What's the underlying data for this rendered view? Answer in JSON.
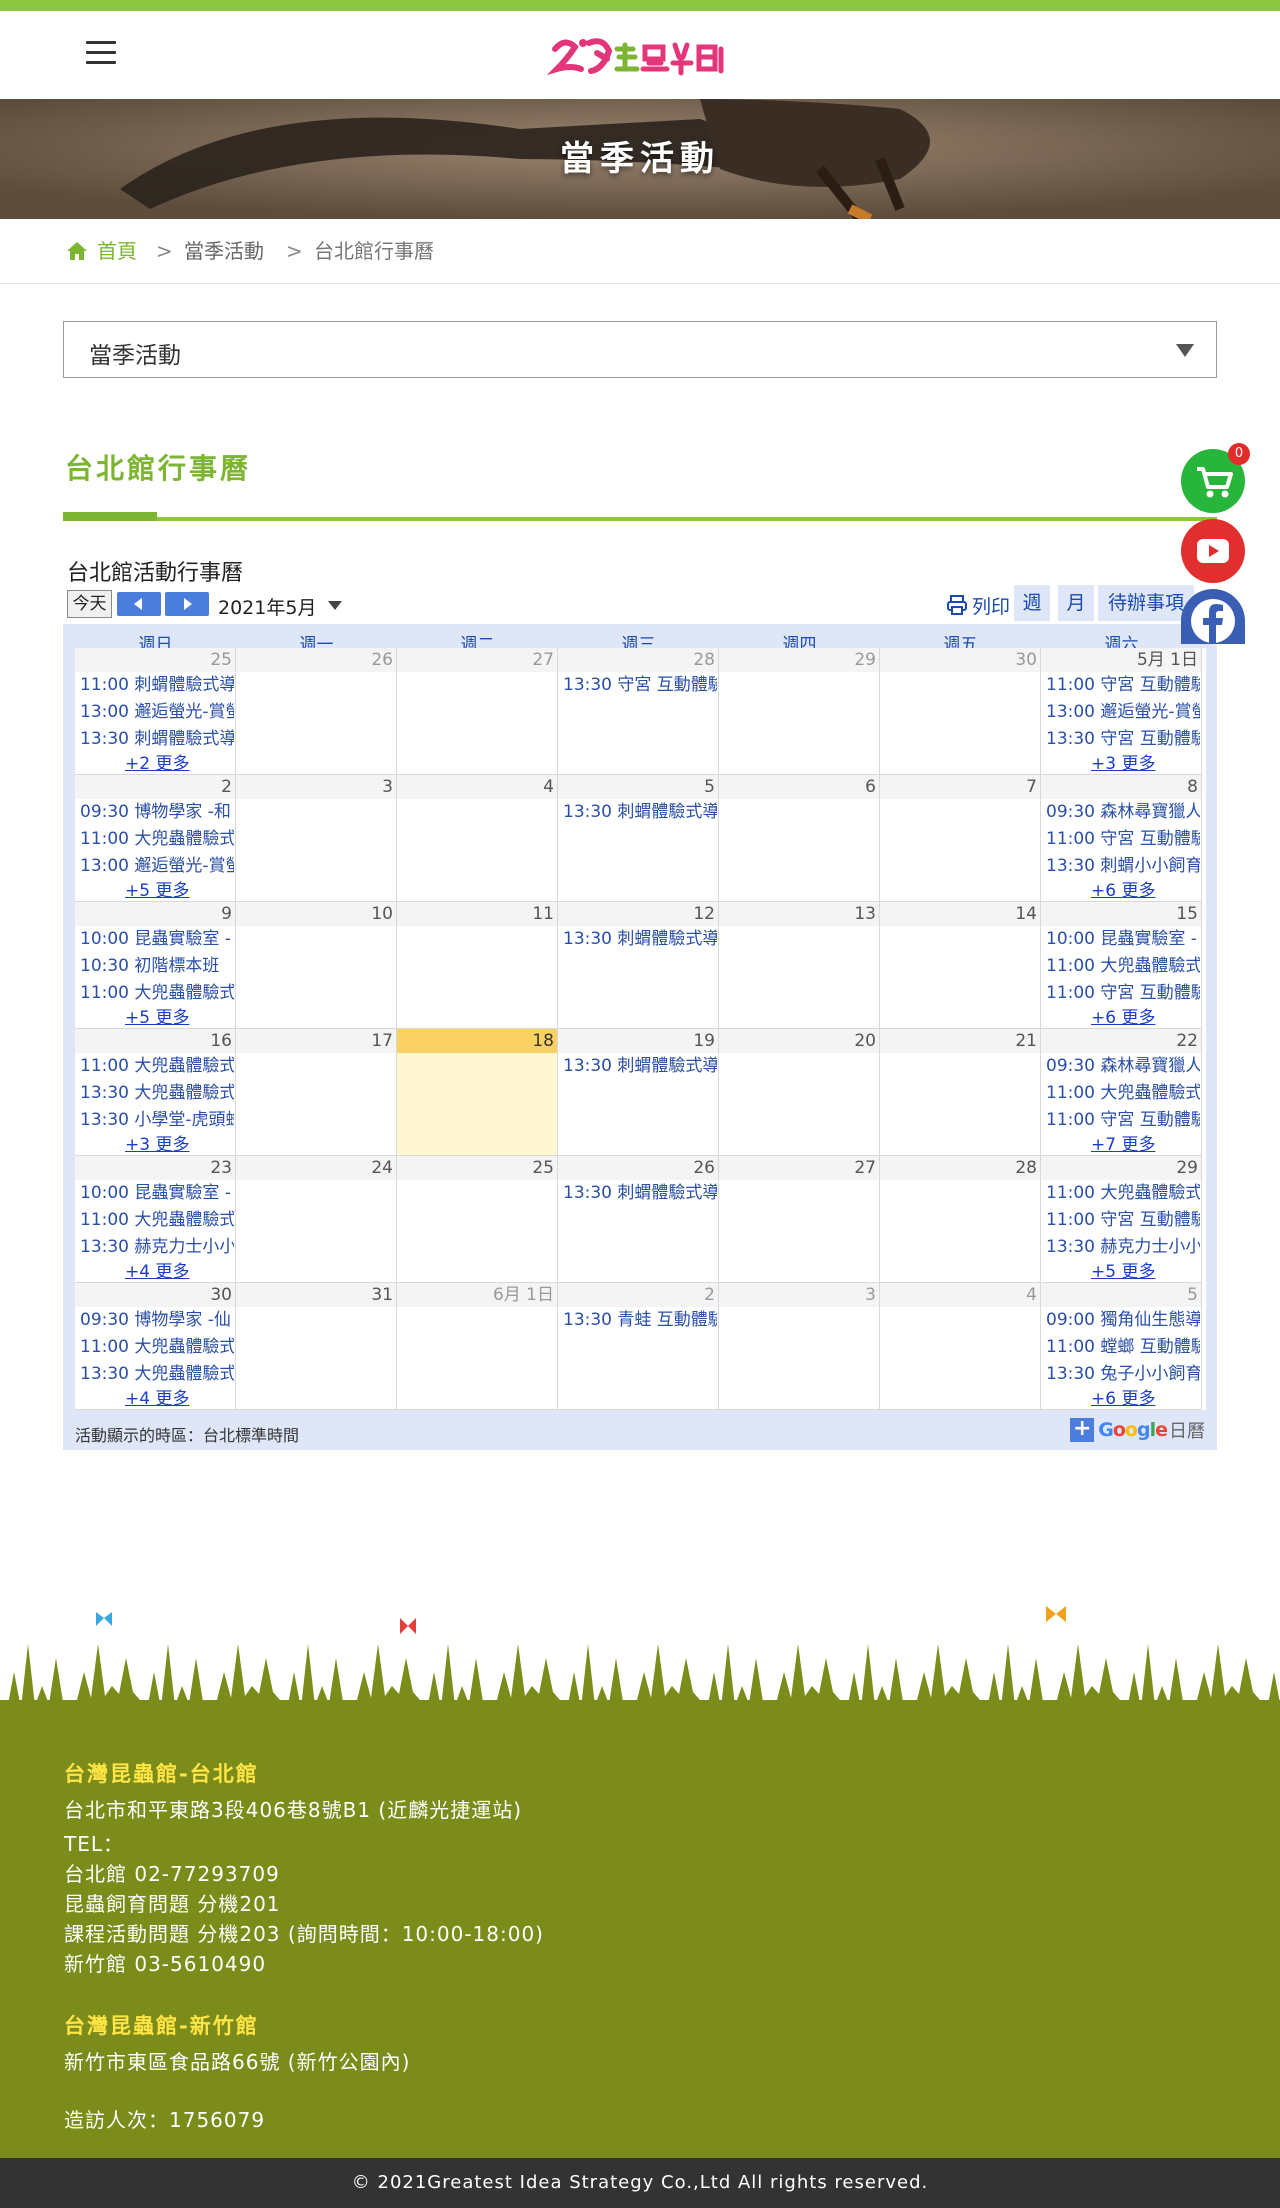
{
  "header": {
    "logo_text": "台灣昆蟲館",
    "banner_title": "當季活動"
  },
  "breadcrumb": {
    "home": "首頁",
    "separator": ">",
    "level2": "當季活動",
    "level3": "台北館行事曆"
  },
  "category_select": {
    "value": "當季活動"
  },
  "section": {
    "title": "台北館行事曆"
  },
  "calendar": {
    "title": "台北館活動行事曆",
    "today_label": "今天",
    "month_label": "2021年5月",
    "print_label": "列印",
    "view_tabs": {
      "week": "週",
      "month": "月",
      "agenda": "待辦事項"
    },
    "weekdays": [
      "週日",
      "週一",
      "週二",
      "週三",
      "週四",
      "週五",
      "週六"
    ],
    "timezone_note": "活動顯示的時區：台北標準時間",
    "google_label": "Google",
    "google_suffix": "日曆",
    "weeks": [
      [
        {
          "day": "25",
          "dim": true,
          "events": [
            "11:00 刺蝟體驗式導",
            "13:00 邂逅螢光-賞螢",
            "13:30 刺蝟體驗式導"
          ],
          "more": "+2 更多"
        },
        {
          "day": "26",
          "dim": true,
          "events": [],
          "more": ""
        },
        {
          "day": "27",
          "dim": true,
          "events": [],
          "more": ""
        },
        {
          "day": "28",
          "dim": true,
          "events": [
            "13:30 守宮 互動體驗"
          ],
          "more": ""
        },
        {
          "day": "29",
          "dim": true,
          "events": [],
          "more": ""
        },
        {
          "day": "30",
          "dim": true,
          "events": [],
          "more": ""
        },
        {
          "day": "5月 1日",
          "dim": false,
          "events": [
            "11:00 守宮 互動體驗",
            "13:00 邂逅螢光-賞螢",
            "13:30 守宮 互動體驗"
          ],
          "more": "+3 更多"
        }
      ],
      [
        {
          "day": "2",
          "dim": false,
          "events": [
            "09:30 博物學家 -和",
            "11:00 大兜蟲體驗式",
            "13:00 邂逅螢光-賞螢"
          ],
          "more": "+5 更多"
        },
        {
          "day": "3",
          "dim": false,
          "events": [],
          "more": ""
        },
        {
          "day": "4",
          "dim": false,
          "events": [],
          "more": ""
        },
        {
          "day": "5",
          "dim": false,
          "events": [
            "13:30 刺蝟體驗式導"
          ],
          "more": ""
        },
        {
          "day": "6",
          "dim": false,
          "events": [],
          "more": ""
        },
        {
          "day": "7",
          "dim": false,
          "events": [],
          "more": ""
        },
        {
          "day": "8",
          "dim": false,
          "events": [
            "09:30 森林尋寶獵人",
            "11:00 守宮 互動體驗",
            "13:30 刺蝟小小飼育"
          ],
          "more": "+6 更多"
        }
      ],
      [
        {
          "day": "9",
          "dim": false,
          "events": [
            "10:00 昆蟲實驗室 -",
            "10:30 初階標本班",
            "11:00 大兜蟲體驗式"
          ],
          "more": "+5 更多"
        },
        {
          "day": "10",
          "dim": false,
          "events": [],
          "more": ""
        },
        {
          "day": "11",
          "dim": false,
          "events": [],
          "more": ""
        },
        {
          "day": "12",
          "dim": false,
          "events": [
            "13:30 刺蝟體驗式導"
          ],
          "more": ""
        },
        {
          "day": "13",
          "dim": false,
          "events": [],
          "more": ""
        },
        {
          "day": "14",
          "dim": false,
          "events": [],
          "more": ""
        },
        {
          "day": "15",
          "dim": false,
          "events": [
            "10:00 昆蟲實驗室 -",
            "11:00 大兜蟲體驗式",
            "11:00 守宮 互動體驗"
          ],
          "more": "+6 更多"
        }
      ],
      [
        {
          "day": "16",
          "dim": false,
          "events": [
            "11:00 大兜蟲體驗式",
            "13:30 大兜蟲體驗式",
            "13:30 小學堂-虎頭蜂"
          ],
          "more": "+3 更多"
        },
        {
          "day": "17",
          "dim": false,
          "events": [],
          "more": ""
        },
        {
          "day": "18",
          "dim": false,
          "today": true,
          "events": [],
          "more": ""
        },
        {
          "day": "19",
          "dim": false,
          "events": [
            "13:30 刺蝟體驗式導"
          ],
          "more": ""
        },
        {
          "day": "20",
          "dim": false,
          "events": [],
          "more": ""
        },
        {
          "day": "21",
          "dim": false,
          "events": [],
          "more": ""
        },
        {
          "day": "22",
          "dim": false,
          "events": [
            "09:30 森林尋寶獵人",
            "11:00 大兜蟲體驗式",
            "11:00 守宮 互動體驗"
          ],
          "more": "+7 更多"
        }
      ],
      [
        {
          "day": "23",
          "dim": false,
          "events": [
            "10:00 昆蟲實驗室 -",
            "11:00 大兜蟲體驗式",
            "13:30 赫克力士小小"
          ],
          "more": "+4 更多"
        },
        {
          "day": "24",
          "dim": false,
          "events": [],
          "more": ""
        },
        {
          "day": "25",
          "dim": false,
          "events": [],
          "more": ""
        },
        {
          "day": "26",
          "dim": false,
          "events": [
            "13:30 刺蝟體驗式導"
          ],
          "more": ""
        },
        {
          "day": "27",
          "dim": false,
          "events": [],
          "more": ""
        },
        {
          "day": "28",
          "dim": false,
          "events": [],
          "more": ""
        },
        {
          "day": "29",
          "dim": false,
          "events": [
            "11:00 大兜蟲體驗式",
            "11:00 守宮 互動體驗",
            "13:30 赫克力士小小"
          ],
          "more": "+5 更多"
        }
      ],
      [
        {
          "day": "30",
          "dim": false,
          "events": [
            "09:30 博物學家 -仙",
            "11:00 大兜蟲體驗式",
            "13:30 大兜蟲體驗式"
          ],
          "more": "+4 更多"
        },
        {
          "day": "31",
          "dim": false,
          "events": [],
          "more": ""
        },
        {
          "day": "6月 1日",
          "dim": true,
          "events": [],
          "more": ""
        },
        {
          "day": "2",
          "dim": true,
          "events": [
            "13:30 青蛙 互動體驗"
          ],
          "more": ""
        },
        {
          "day": "3",
          "dim": true,
          "events": [],
          "more": ""
        },
        {
          "day": "4",
          "dim": true,
          "events": [],
          "more": ""
        },
        {
          "day": "5",
          "dim": true,
          "events": [
            "09:00 獨角仙生態導",
            "11:00 螳螂 互動體驗",
            "13:30 兔子小小飼育"
          ],
          "more": "+6 更多"
        }
      ]
    ]
  },
  "floating": {
    "cart_count": "0"
  },
  "footer": {
    "taipei_title": "台灣昆蟲館-台北館",
    "taipei_address": "台北市和平東路3段406巷8號B1 (近麟光捷運站)",
    "tel_label": "TEL：",
    "tel_taipei": "台北館 02-77293709",
    "tel_breeding": "昆蟲飼育問題 分機201",
    "tel_course": "課程活動問題 分機203 (詢問時間：10:00-18:00)",
    "tel_hsinchu": "新竹館 03-5610490",
    "hsinchu_title": "台灣昆蟲館-新竹館",
    "hsinchu_address": "新竹市東區食品路66號 (新竹公園內)",
    "visitors": "造訪人次：1756079",
    "copyright": "© 2021Greatest Idea Strategy Co.,Ltd All rights reserved."
  },
  "colors": {
    "brand_green": "#8cc63f",
    "footer_olive": "#7b8c1a",
    "footer_heading": "#ffe445",
    "calendar_blue": "#4a7ddc"
  }
}
